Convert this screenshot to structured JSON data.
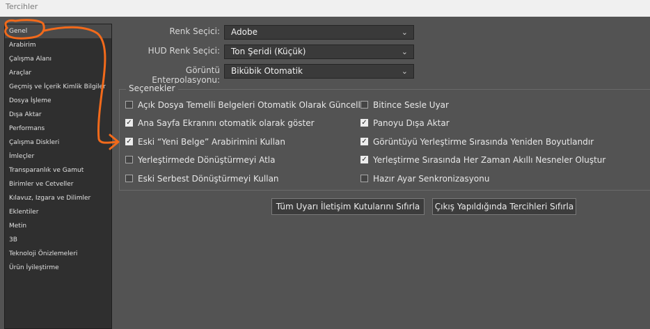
{
  "window": {
    "title": "Tercihler"
  },
  "sidebar": {
    "items": [
      {
        "label": "Genel"
      },
      {
        "label": "Arabirim"
      },
      {
        "label": "Çalışma Alanı"
      },
      {
        "label": "Araçlar"
      },
      {
        "label": "Geçmiş ve İçerik Kimlik Bilgiler"
      },
      {
        "label": "Dosya İşleme"
      },
      {
        "label": "Dışa Aktar"
      },
      {
        "label": "Performans"
      },
      {
        "label": "Çalışma Diskleri"
      },
      {
        "label": "İmleçler"
      },
      {
        "label": "Transparanlık ve Gamut"
      },
      {
        "label": "Birimler ve Cetveller"
      },
      {
        "label": "Kılavuz, Izgara ve Dilimler"
      },
      {
        "label": "Eklentiler"
      },
      {
        "label": "Metin"
      },
      {
        "label": "3B"
      },
      {
        "label": "Teknoloji Önizlemeleri"
      },
      {
        "label": "Ürün İyileştirme"
      }
    ],
    "selected": "Genel"
  },
  "fields": {
    "color_picker": {
      "label": "Renk Seçici:",
      "value": "Adobe"
    },
    "hud_color_picker": {
      "label": "HUD Renk Seçici:",
      "value": "Ton Şeridi (Küçük)"
    },
    "interpolation": {
      "label": "Görüntü Enterpolasyonu:",
      "value": "Bikübik Otomatik"
    }
  },
  "options": {
    "legend": "Seçenekler",
    "left": [
      {
        "label": "Açık Dosya Temelli Belgeleri Otomatik Olarak Güncelle",
        "checked": false
      },
      {
        "label": "Ana Sayfa Ekranını otomatik olarak göster",
        "checked": true
      },
      {
        "label": "Eski “Yeni Belge” Arabirimini Kullan",
        "checked": true
      },
      {
        "label": "Yerleştirmede Dönüştürmeyi Atla",
        "checked": false
      },
      {
        "label": "Eski Serbest Dönüştürmeyi Kullan",
        "checked": false
      }
    ],
    "right": [
      {
        "label": "Bitince Sesle Uyar",
        "checked": false
      },
      {
        "label": "Panoyu Dışa Aktar",
        "checked": true
      },
      {
        "label": "Görüntüyü Yerleştirme Sırasında Yeniden Boyutlandır",
        "checked": true
      },
      {
        "label": "Yerleştirme Sırasında Her Zaman Akıllı Nesneler Oluştur",
        "checked": true
      },
      {
        "label": "Hazır Ayar Senkronizasyonu",
        "checked": false
      }
    ]
  },
  "buttons": {
    "reset_warnings": "Tüm Uyarı İletişim Kutularını Sıfırla",
    "reset_prefs": "Çıkış Yapıldığında Tercihleri Sıfırla"
  },
  "icons": {
    "check": "✓",
    "chevron": "⌄"
  },
  "colors": {
    "annotation": "#f26a1b",
    "panel": "#535353",
    "sidebar": "#2f2f2f"
  }
}
